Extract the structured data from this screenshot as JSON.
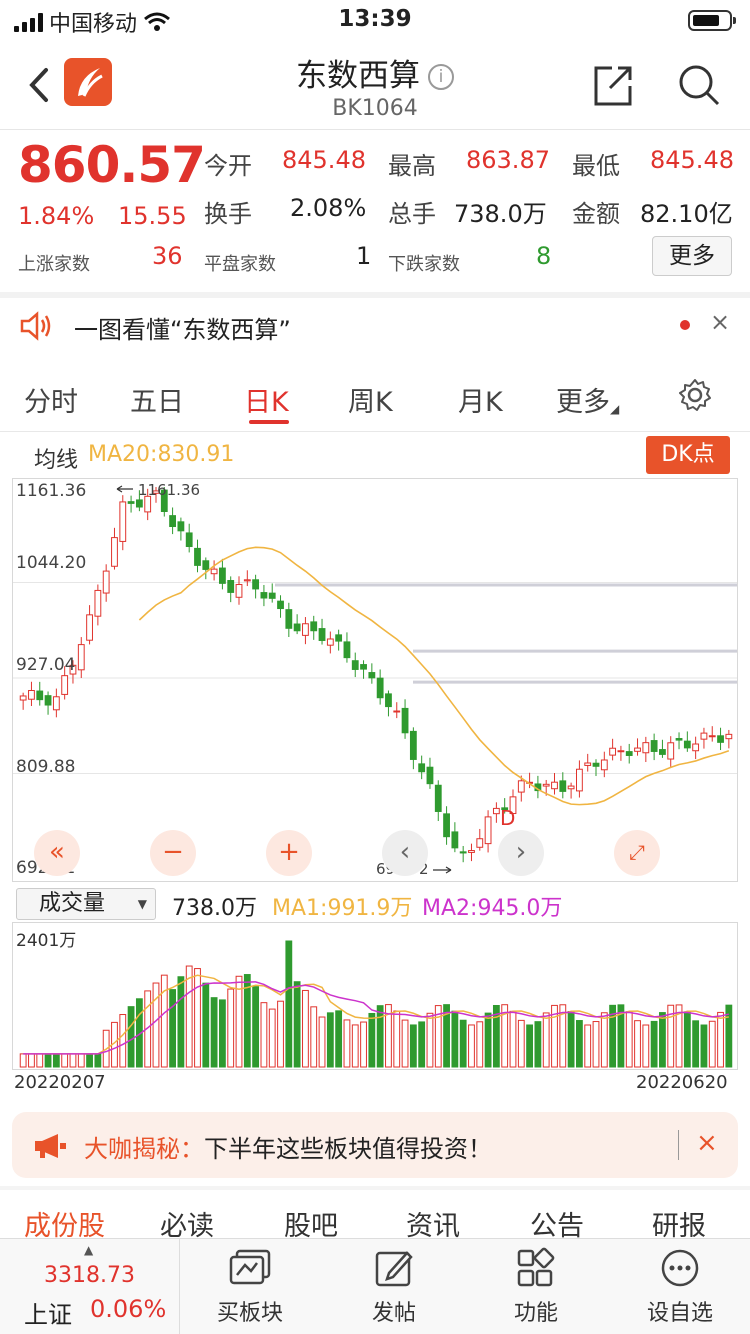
{
  "status_bar": {
    "carrier": "中国移动",
    "time": "13:39"
  },
  "nav": {
    "title": "东数西算",
    "code": "BK1064",
    "info": "i"
  },
  "quote": {
    "price": "860.57",
    "change_pct": "1.84%",
    "change": "15.55",
    "open_label": "今开",
    "open": "845.48",
    "high_label": "最高",
    "high": "863.87",
    "low_label": "最低",
    "low": "845.48",
    "turnover_label": "换手",
    "turnover": "2.08%",
    "volume_label": "总手",
    "volume": "738.0万",
    "amount_label": "金额",
    "amount": "82.10亿",
    "up_label": "上涨家数",
    "up_count": "36",
    "flat_label": "平盘家数",
    "flat_count": "1",
    "down_label": "下跌家数",
    "down_count": "8",
    "more": "更多"
  },
  "news": {
    "text": "一图看懂“东数西算”",
    "close": "×"
  },
  "tabs": [
    {
      "label": "分时"
    },
    {
      "label": "五日"
    },
    {
      "label": "日K"
    },
    {
      "label": "周K"
    },
    {
      "label": "月K"
    },
    {
      "label": "更多"
    }
  ],
  "kline": {
    "ma_label": "均线",
    "ma20": "MA20:830.91",
    "dk_button": "DK点",
    "y_labels": [
      "1161.36",
      "1044.20",
      "927.04",
      "809.88",
      "692.72"
    ],
    "max_annot": "1161.36",
    "min_annot": "692.72",
    "signal": "D"
  },
  "volume": {
    "selector": "成交量",
    "current": "738.0万",
    "ma1": "MA1:991.9万",
    "ma2": "MA2:945.0万",
    "max_label": "2401万",
    "start_date": "20220207",
    "end_date": "20220620"
  },
  "banner": {
    "prefix": "大咖揭秘：",
    "text": "下半年这些板块值得投资！",
    "close": "×"
  },
  "subtabs": [
    "成份股",
    "必读",
    "股吧",
    "资讯",
    "公告",
    "研报"
  ],
  "bottom": {
    "index_value": "3318.73",
    "index_name": "上证",
    "index_pct": "0.06%",
    "items": [
      {
        "label": "买板块",
        "icon": "buy-sector-icon"
      },
      {
        "label": "发帖",
        "icon": "post-icon"
      },
      {
        "label": "功能",
        "icon": "functions-icon"
      },
      {
        "label": "设自选",
        "icon": "add-watchlist-icon"
      }
    ]
  },
  "colors": {
    "up": "#e0332d",
    "down": "#2f9a2f",
    "accent": "#e8532a",
    "ma1": "#f0b542",
    "ma2": "#cc33cc"
  },
  "chart_data": [
    {
      "type": "candlestick",
      "title": "",
      "ylim": [
        692.72,
        1161.36
      ],
      "y_ticks": [
        1161.36,
        1044.2,
        927.04,
        809.88,
        692.72
      ],
      "max": 1161.36,
      "min": 692.72,
      "ma20_last": 830.91,
      "trend_note_values": [
        905,
        900,
        1000,
        1140,
        1150,
        1080,
        1040,
        1040,
        990,
        980,
        940,
        890,
        800,
        700,
        760,
        800,
        790,
        825,
        840,
        840,
        850,
        858
      ]
    },
    {
      "type": "bar",
      "title": "",
      "ylim": [
        0,
        2401
      ],
      "unit": "万",
      "x_range": [
        "20220207",
        "20220620"
      ],
      "last_volume": 738.0,
      "ma1": 991.9,
      "ma2": 945.0
    }
  ]
}
